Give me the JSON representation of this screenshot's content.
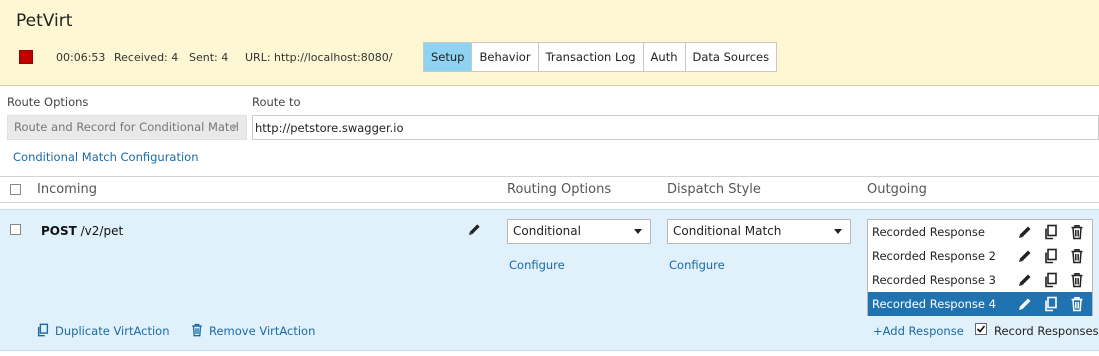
{
  "header": {
    "app_title": "PetVirt",
    "timer": "00:06:53",
    "received": "Received: 4",
    "sent": "Sent: 4",
    "url": "URL: http://localhost:8080/",
    "tabs": [
      "Setup",
      "Behavior",
      "Transaction Log",
      "Auth",
      "Data Sources"
    ],
    "active_tab": "Setup",
    "colors": {
      "background": "#fdf8d3",
      "stop": "#c00000",
      "active_tab": "#8fd3f3"
    }
  },
  "route": {
    "options_label": "Route Options",
    "options_value": "Route and Record for Conditional Matcl",
    "route_to_label": "Route to",
    "route_to_value": "http://petstore.swagger.io",
    "conditional_link": "Conditional Match Configuration"
  },
  "table": {
    "headers": {
      "incoming": "Incoming",
      "routing": "Routing Options",
      "dispatch": "Dispatch Style",
      "outgoing": "Outgoing"
    },
    "row": {
      "method": "POST",
      "path": " /v2/pet",
      "routing_value": "Conditional",
      "routing_link": "Configure",
      "dispatch_value": "Conditional Match",
      "dispatch_link": "Configure",
      "responses": [
        "Recorded Response",
        "Recorded Response 2",
        "Recorded Response 3",
        "Recorded Response 4"
      ],
      "selected_response": "Recorded Response 4",
      "add_response": "+Add Response",
      "record_responses": "Record Responses",
      "record_responses_checked": true,
      "duplicate": "Duplicate VirtAction",
      "remove": "Remove VirtAction"
    },
    "colors": {
      "row_bg": "#e1f1fb",
      "selected": "#1e73b0",
      "link": "#1a6aa6"
    }
  },
  "icons": [
    "stop-icon",
    "pencil-icon",
    "copy-icon",
    "trash-icon",
    "chevron-down-icon",
    "checkbox-icon"
  ]
}
